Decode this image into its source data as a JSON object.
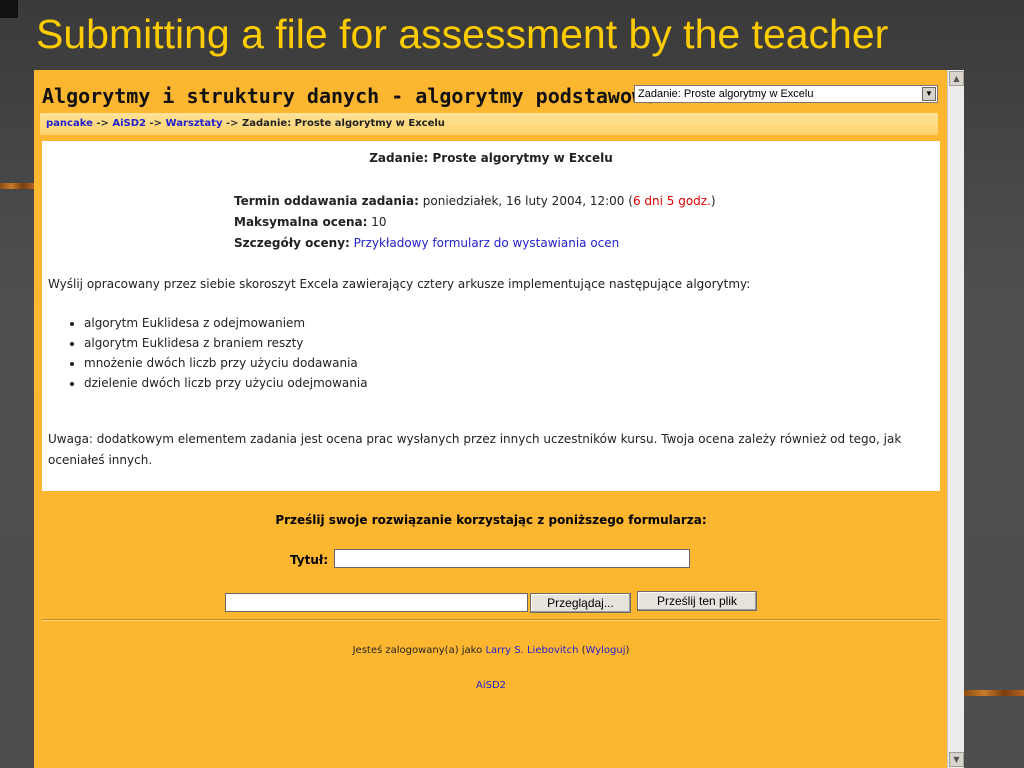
{
  "slide": {
    "title": "Submitting a file for assessment by the teacher"
  },
  "site": {
    "title": "Algorytmy i struktury danych - algorytmy podstawowe",
    "jump_select_value": "Zadanie: Proste algorytmy w Excelu"
  },
  "breadcrumb": {
    "items": [
      "pancake",
      "AiSD2",
      "Warsztaty"
    ],
    "separator": "->",
    "current": "Zadanie: Proste algorytmy w Excelu"
  },
  "assignment": {
    "heading": "Zadanie: Proste algorytmy w Excelu",
    "deadline_label": "Termin oddawania zadania:",
    "deadline_value": "poniedziałek, 16 luty 2004, 12:00",
    "deadline_remaining": "6 dni 5 godz.",
    "max_grade_label": "Maksymalna ocena:",
    "max_grade_value": "10",
    "grading_label": "Szczegóły oceny:",
    "grading_link": "Przykładowy formularz do wystawiania ocen",
    "intro": "Wyślij opracowany przez siebie skoroszyt Excela zawierający cztery arkusze implementujące następujące algorytmy:",
    "algorithms": [
      "algorytm Euklidesa z odejmowaniem",
      "algorytm Euklidesa z braniem reszty",
      "mnożenie dwóch liczb przy użyciu dodawania",
      "dzielenie dwóch liczb przy użyciu odejmowania"
    ],
    "note": "Uwaga: dodatkowym elementem zadania jest ocena prac wysłanych przez innych uczestników kursu. Twoja ocena zależy również od tego, jak oceniałeś innych."
  },
  "upload": {
    "heading": "Prześlij swoje rozwiązanie korzystając z poniższego formularza:",
    "title_label": "Tytuł:",
    "title_value": "",
    "file_value": "",
    "browse_label": "Przeglądaj...",
    "send_label": "Prześlij ten plik"
  },
  "footer": {
    "logged_in_text": "Jesteś zalogowany(a) jako",
    "user_name": "Larry S. Liebovitch",
    "logout_label": "Wyloguj",
    "course_link": "AiSD2"
  }
}
